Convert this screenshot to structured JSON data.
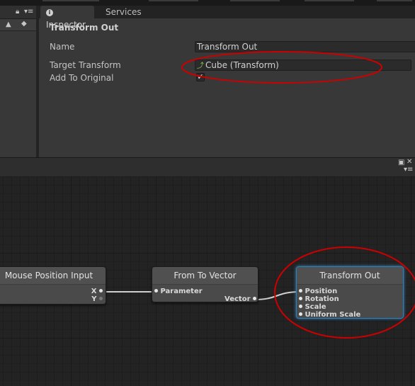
{
  "tabs": {
    "inspector": "Inspector",
    "services": "Services"
  },
  "inspector": {
    "title": "Transform Out",
    "name_label": "Name",
    "name_value": "Transform Out",
    "target_label": "Target Transform",
    "target_value": "Cube (Transform)",
    "add_label": "Add To Original",
    "add_checked": true
  },
  "graph": {
    "nodes": {
      "mouse": {
        "title": "Mouse Position Input",
        "ports": [
          "X",
          "Y"
        ]
      },
      "from": {
        "title": "From To Vector",
        "input": "Parameter",
        "output": "Vector"
      },
      "out": {
        "title": "Transform Out",
        "ports": [
          "Position",
          "Rotation",
          "Scale",
          "Uniform Scale"
        ]
      }
    }
  },
  "annotation_color": "#cc0000",
  "accent_color": "#3e9be0"
}
